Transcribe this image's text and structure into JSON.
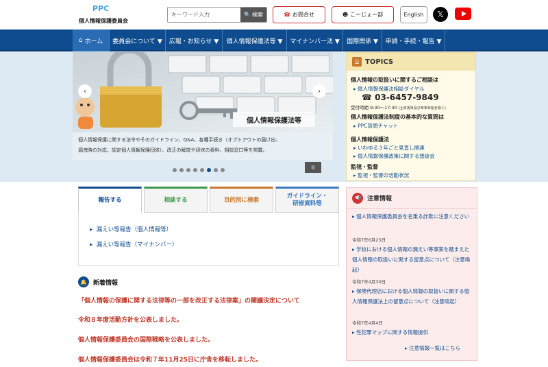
{
  "header": {
    "logo_mark": "PPC",
    "logo_text": "個人情報保護委員会",
    "search_placeholder": "キーワード入力",
    "search_button": "検索",
    "contact_button": "お問合せ",
    "kojo_button": "こーじょー部",
    "english_button": "English"
  },
  "nav": {
    "items": [
      "ホーム",
      "委員会について ▼",
      "広報・お知らせ ▼",
      "個人情報保護法等 ▼",
      "マイナンバー法 ▼",
      "国際関係 ▼",
      "申請・手続・報告 ▼"
    ]
  },
  "slider": {
    "slide_label": "個人情報保護法等",
    "caption_line1": "個人情報保護に関する法令やそのガイドライン、Q&A、各種手続き（オプトアウトの届け出、",
    "caption_line2": "漏洩時の対応、認定個人情報保護団体）、改正の解説や研修の資料、相談窓口等を掲載。",
    "pause": "II"
  },
  "topics": {
    "title": "TOPICS",
    "consult_heading": "個人情報の取扱いに関するご相談は",
    "consult_dial": "個人情報保護法相談ダイヤル",
    "phone": "03-6457-9849",
    "hours": "受付時間 9:30〜17:30",
    "hours_note": "(土日祝日及び年末年始を除く)",
    "mynumber_heading": "個人情報保護法制度の基本的な質問は",
    "ppc_chat": "PPC質問チャット",
    "law_heading": "個人情報保護法",
    "law_item1": "いわゆる３年ごと見直し関連",
    "law_item2": "個人情報保護政策に関する懇談会",
    "supervision_heading": "監視・監督",
    "supervision_item": "監視・監督の活動状況"
  },
  "tabs": {
    "items": [
      "報告する",
      "相談する",
      "目的別に検索",
      "ガイドライン・\n研修資料等"
    ],
    "panel_links": [
      "漏えい等報告（個人情報等）",
      "漏えい等報告（マイナンバー）"
    ]
  },
  "news": {
    "title": "新着情報",
    "items": [
      "「個人情報の保護に関する法律等の一部を改正する法律案」の閣議決定について",
      "令和８年度活動方針を公表しました。",
      "個人情報保護委員会の国際戦略を公表しました。",
      "個人情報保護委員会は令和７年11月25日に庁舎を移転しました。"
    ]
  },
  "alert": {
    "title": "注意情報",
    "item1": "個人情報保護委員会を名乗る詐欺に注意ください",
    "date1": "令和7年6月25日",
    "item2": "学校における個人情報の漏えい等事案を踏まえた個人情報の取扱いに関する留意点について（注意喚起）",
    "date2": "令和7年4月30日",
    "item3": "保険代理店における個人情報の取扱いに関する個人情報保護法上の留意点について（注意喚起）",
    "date3": "令和7年4月4日",
    "item4": "性犯罪マップに関する情報提供",
    "more": "注意情報一覧はこちら"
  },
  "colors": {
    "nav_bg": "#0e4c8f",
    "news_text": "#c0392b",
    "tab1": "#0e4c8f",
    "tab2": "#3a9a4a",
    "tab3": "#c8782a",
    "tab4": "#3a7ac0"
  }
}
